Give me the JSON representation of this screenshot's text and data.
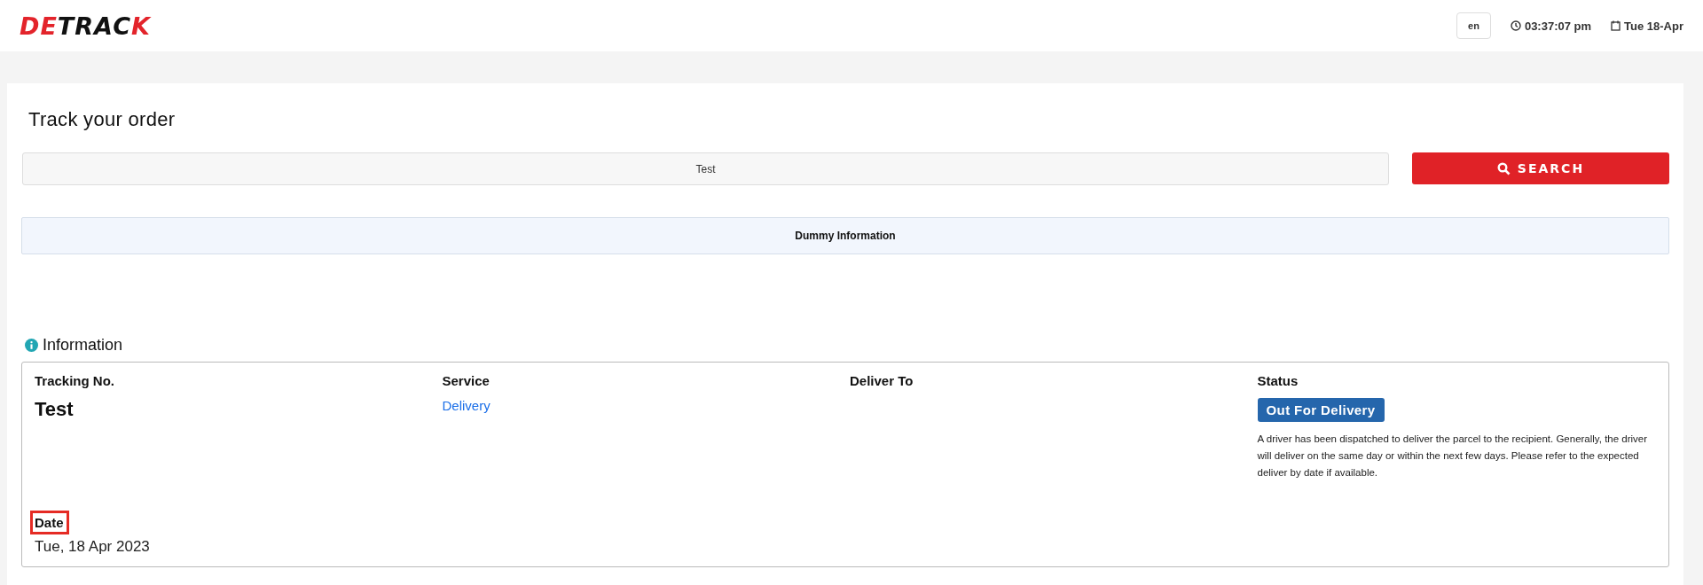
{
  "header": {
    "logo": [
      {
        "text": "DE",
        "color": "#e3242b"
      },
      {
        "text": "TRAC",
        "color": "#111111"
      },
      {
        "text": "K",
        "color": "#e3242b"
      }
    ],
    "language": "en",
    "time": "03:37:07 pm",
    "date": "Tue 18-Apr"
  },
  "page": {
    "title": "Track your order",
    "search": {
      "value": "Test",
      "button": "SEARCH"
    },
    "notice": "Dummy Information"
  },
  "information": {
    "heading": "Information",
    "fields": [
      {
        "label": "Tracking No.",
        "value": "Test",
        "kind": "large",
        "highlighted": false
      },
      {
        "label": "Service",
        "value": "Delivery",
        "kind": "link",
        "highlighted": false
      },
      {
        "label": "Deliver To",
        "kind": "empty",
        "highlighted": false
      },
      {
        "label": "Status",
        "value": "Out For Delivery",
        "kind": "status",
        "description": "A driver has been dispatched to deliver the parcel to the recipient. Generally, the driver will deliver on the same day or within the next few days. Please refer to the expected deliver by date if available.",
        "highlighted": false
      },
      {
        "label": "Date",
        "value": "Tue, 18 Apr 2023",
        "kind": "plain",
        "highlighted": true
      }
    ]
  }
}
